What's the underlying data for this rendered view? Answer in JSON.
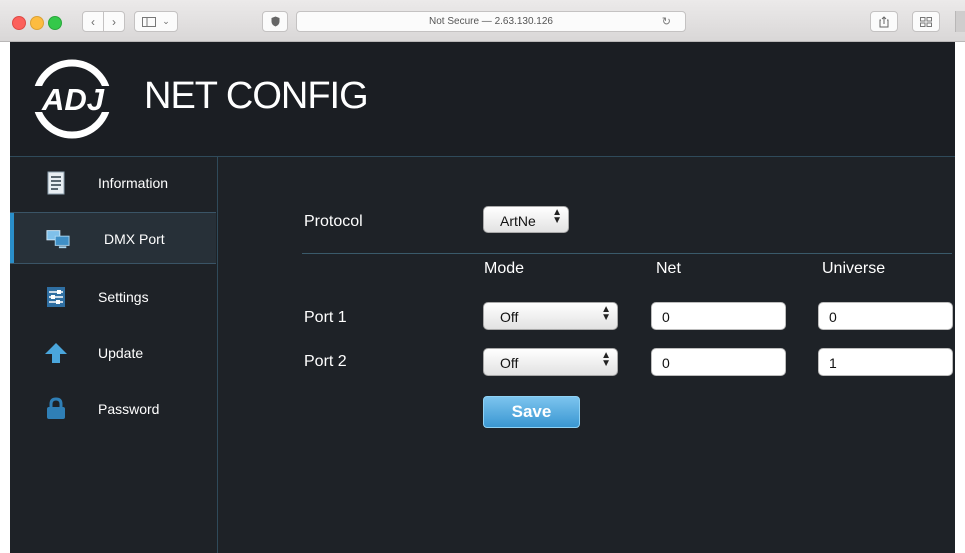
{
  "browser": {
    "url": "Not Secure — 2.63.130.126"
  },
  "app": {
    "title": "NET CONFIG",
    "logo_text": "ADJ"
  },
  "sidebar": {
    "items": [
      {
        "label": "Information",
        "icon": "document-icon",
        "active": false
      },
      {
        "label": "DMX Port",
        "icon": "monitor-icon",
        "active": true
      },
      {
        "label": "Settings",
        "icon": "sliders-icon",
        "active": false
      },
      {
        "label": "Update",
        "icon": "arrow-up-icon",
        "active": false
      },
      {
        "label": "Password",
        "icon": "lock-icon",
        "active": false
      }
    ]
  },
  "form": {
    "protocol_label": "Protocol",
    "protocol_value": "ArtNe",
    "headers": {
      "mode": "Mode",
      "net": "Net",
      "universe": "Universe"
    },
    "ports": [
      {
        "label": "Port 1",
        "mode": "Off",
        "net": "0",
        "universe": "0"
      },
      {
        "label": "Port 2",
        "mode": "Off",
        "net": "0",
        "universe": "1"
      }
    ],
    "save_label": "Save"
  },
  "colors": {
    "background": "#1e2227",
    "accent": "#2a8ec9",
    "save_button": "#4aa6dc"
  }
}
